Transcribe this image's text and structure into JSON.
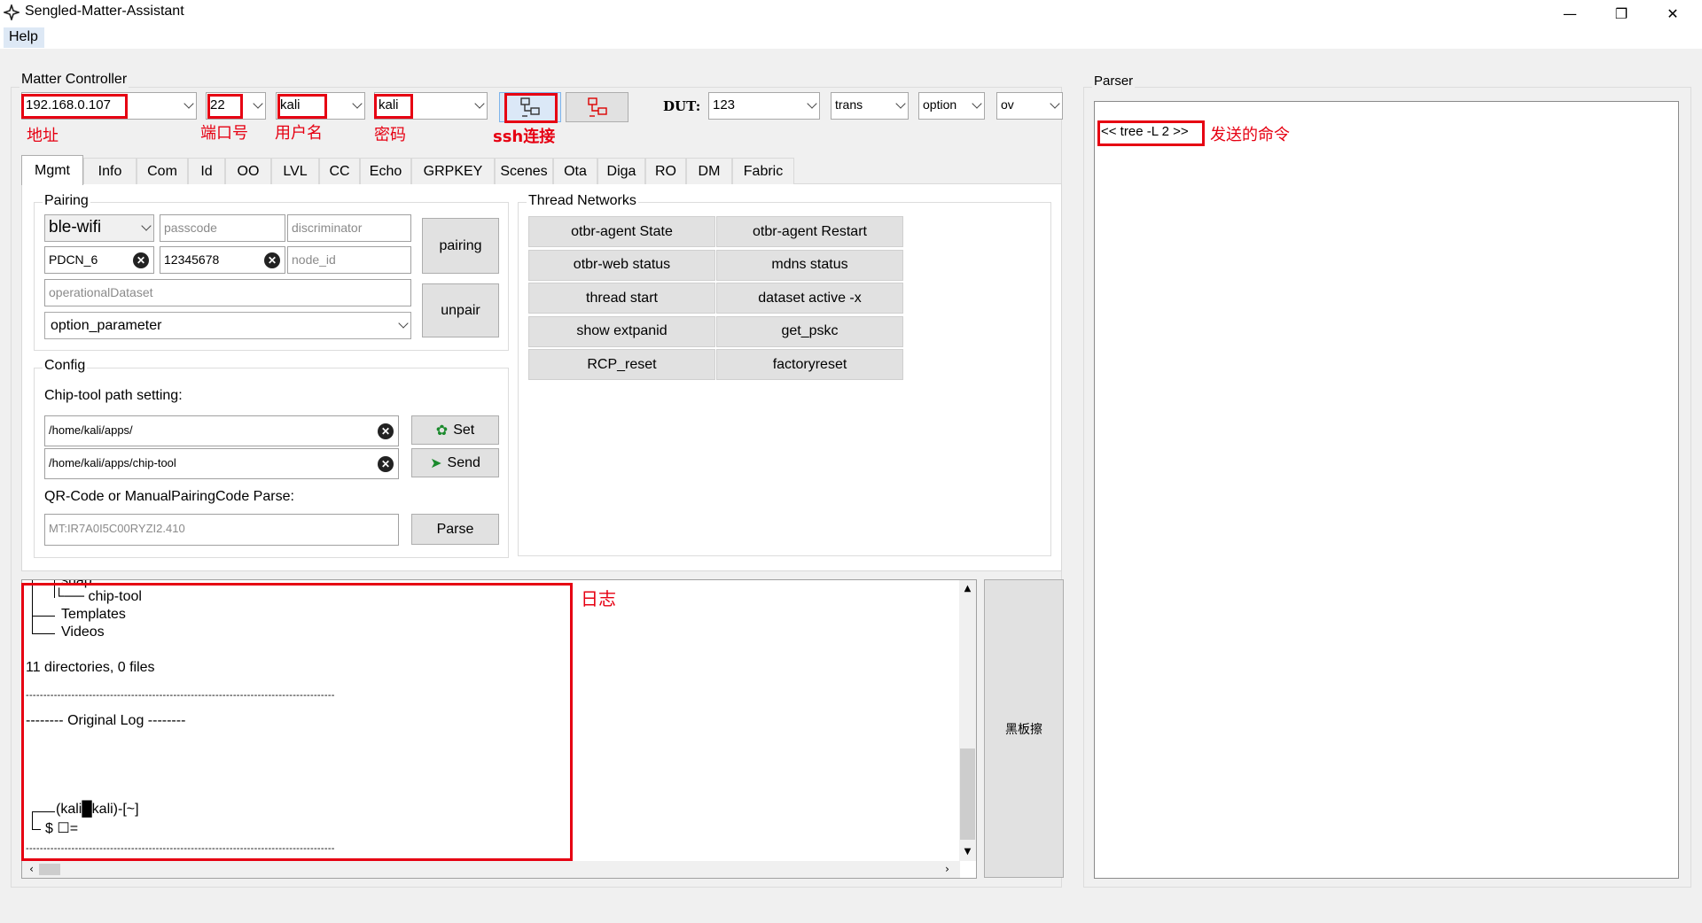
{
  "window": {
    "title": "Sengled-Matter-Assistant",
    "minimize": "—",
    "maximize": "❐",
    "close": "✕"
  },
  "menu": {
    "help": "Help"
  },
  "controller": {
    "title": "Matter Controller",
    "ip": "192.168.0.107",
    "port": "22",
    "username": "kali",
    "password": "kali",
    "dut_label": "DUT:",
    "dut": "123",
    "trans": "trans",
    "option": "option",
    "ov": "ov"
  },
  "annotations": {
    "address": "地址",
    "port": "端口号",
    "username": "用户名",
    "password": "密码",
    "ssh": "ssh连接",
    "log": "日志",
    "sent_command": "发送的命令"
  },
  "tabs": [
    "Mgmt",
    "Info",
    "Com",
    "Id",
    "OO",
    "LVL",
    "CC",
    "Echo",
    "GRPKEY",
    "Scenes",
    "Ota",
    "Diga",
    "RO",
    "DM",
    "Fabric"
  ],
  "pairing": {
    "title": "Pairing",
    "mode": "ble-wifi",
    "passcode_placeholder": "passcode",
    "discriminator_placeholder": "discriminator",
    "ssid": "PDCN_6",
    "wifi_password": "12345678",
    "node_id_placeholder": "node_id",
    "dataset_placeholder": "operationalDataset",
    "option_parameter": "option_parameter",
    "pairing_button": "pairing",
    "unpair_button": "unpair"
  },
  "config": {
    "title": "Config",
    "path_label": "Chip-tool path setting:",
    "apps_path": "/home/kali/apps/",
    "chiptool_path": "/home/kali/apps/chip-tool",
    "set_button": "Set",
    "send_button": "Send",
    "qr_label": "QR-Code or ManualPairingCode Parse:",
    "qr_placeholder": "MT:IR7A0I5C00RYZI2.410",
    "parse_button": "Parse"
  },
  "thread": {
    "title": "Thread Networks",
    "buttons": [
      "otbr-agent State",
      "otbr-agent Restart",
      "otbr-web status",
      "mdns status",
      "thread start",
      "dataset active -x",
      "show extpanid",
      "get_pskc",
      "RCP_reset",
      "factoryreset"
    ]
  },
  "log": {
    "lines": [
      "snap",
      "└── chip-tool",
      "Templates",
      "Videos",
      "11 directories, 0 files",
      "----------------------------------------------------------------------------------------",
      "-------- Original Log --------",
      "(kali█kali)-[~]",
      "$ ☐="
    ],
    "clear_button": "黑板擦"
  },
  "parser": {
    "title": "Parser",
    "command": "<< tree -L 2 >>"
  }
}
